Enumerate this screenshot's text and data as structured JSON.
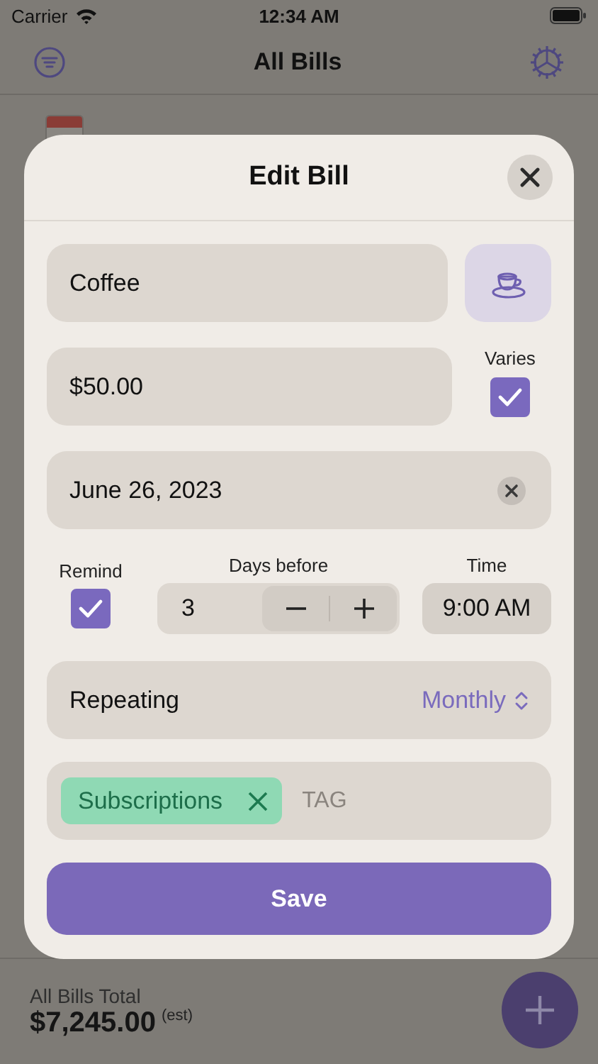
{
  "status_bar": {
    "carrier": "Carrier",
    "time": "12:34 AM"
  },
  "nav": {
    "title": "All Bills"
  },
  "edit_bill": {
    "title": "Edit Bill",
    "name": {
      "value": "Coffee"
    },
    "amount": {
      "value": "$50.00"
    },
    "varies": {
      "label": "Varies",
      "checked": true
    },
    "date": {
      "value": "June 26, 2023"
    },
    "remind": {
      "label": "Remind",
      "checked": true
    },
    "days_before": {
      "label": "Days before",
      "value": "3"
    },
    "time": {
      "label": "Time",
      "value": "9:00 AM"
    },
    "repeating": {
      "label": "Repeating",
      "value": "Monthly"
    },
    "tags": [
      {
        "label": "Subscriptions",
        "color": "#8fd9b4"
      }
    ],
    "tag_input": {
      "placeholder": "TAG"
    },
    "save": "Save"
  },
  "footer": {
    "label": "All Bills Total",
    "total": "$7,245.00",
    "note": "(est)"
  }
}
